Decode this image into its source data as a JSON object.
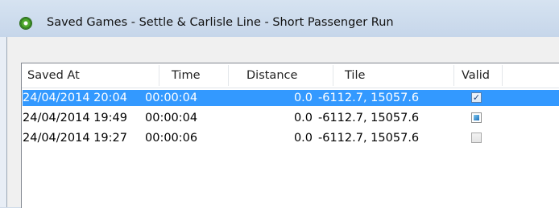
{
  "window": {
    "title": "Saved Games - Settle & Carlisle Line - Short Passenger Run",
    "app_icon": "train-app-icon"
  },
  "list": {
    "columns": [
      "Saved At",
      "Time",
      "Distance",
      "Tile",
      "Valid"
    ],
    "rows": [
      {
        "saved_at": "24/04/2014 20:04",
        "time": "00:00:04",
        "distance": "0.0",
        "tile": "-6112.7, 15057.6",
        "valid": "checked",
        "selected": true
      },
      {
        "saved_at": "24/04/2014 19:49",
        "time": "00:00:04",
        "distance": "0.0",
        "tile": "-6112.7, 15057.6",
        "valid": "indeterminate",
        "selected": false
      },
      {
        "saved_at": "24/04/2014 19:27",
        "time": "00:00:06",
        "distance": "0.0",
        "tile": "-6112.7, 15057.6",
        "valid": "unchecked",
        "selected": false
      }
    ]
  },
  "colors": {
    "selection": "#3399ff"
  }
}
